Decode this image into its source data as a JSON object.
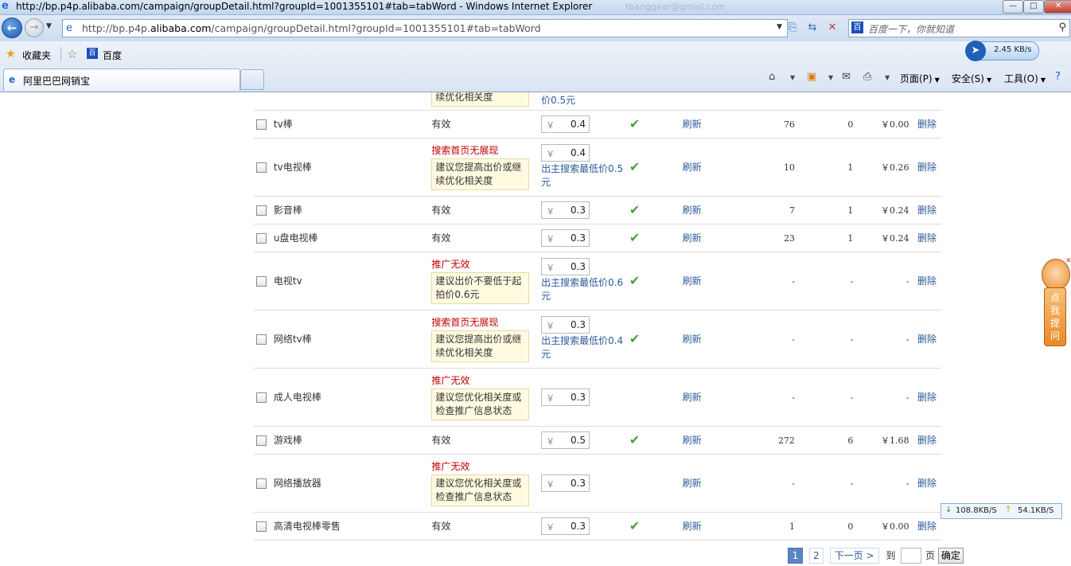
{
  "window": {
    "title": "http://bp.p4p.alibaba.com/campaign/groupDetail.html?groupId=1001355101#tab=tabWord - Windows Internet Explorer",
    "user": "tbanggear@gmail.com",
    "controls": {
      "min": "—",
      "max": "□",
      "close": "✕"
    }
  },
  "address": {
    "url_prefix": "http://bp.p4p.",
    "url_domain": "alibaba.com",
    "url_suffix": "/campaign/groupDetail.html?groupId=1001355101#tab=tabWord"
  },
  "search": {
    "placeholder": "百度一下，你就知道"
  },
  "favorites": {
    "label": "收藏夹",
    "items": [
      "百度"
    ]
  },
  "speed_badge": "2.45 KB/s",
  "tab": {
    "label": "阿里巴巴网销宝"
  },
  "commands": {
    "page": "页面(P)",
    "safety": "安全(S)",
    "tools": "工具(O)"
  },
  "top_partial": {
    "note": "续优化相关度",
    "hint": "价0.5元"
  },
  "rows": [
    {
      "word": "tv棒",
      "status": "有效",
      "bid": "0.4",
      "ok": true,
      "refresh": "刷新",
      "n1": "76",
      "n2": "0",
      "n3": "￥0.00",
      "del": "删除"
    },
    {
      "word": "tv电视棒",
      "status_red": "搜索首页无展现",
      "note": "建议您提高出价或继续优化相关度",
      "bid": "0.4",
      "hint": "出主搜索最低价0.5元",
      "ok": true,
      "refresh": "刷新",
      "n1": "10",
      "n2": "1",
      "n3": "￥0.26",
      "del": "删除"
    },
    {
      "word": "影音棒",
      "status": "有效",
      "bid": "0.3",
      "ok": true,
      "refresh": "刷新",
      "n1": "7",
      "n2": "1",
      "n3": "￥0.24",
      "del": "删除"
    },
    {
      "word": "u盘电视棒",
      "status": "有效",
      "bid": "0.3",
      "ok": true,
      "refresh": "刷新",
      "n1": "23",
      "n2": "1",
      "n3": "￥0.24",
      "del": "删除"
    },
    {
      "word": "电视tv",
      "status_red": "推广无效",
      "note": "建议出价不要低于起拍价0.6元",
      "bid": "0.3",
      "hint": "出主搜索最低价0.6元",
      "ok": true,
      "refresh": "刷新",
      "n1": "-",
      "n2": "-",
      "n3": "-",
      "del": "删除"
    },
    {
      "word": "网络tv棒",
      "status_red": "搜索首页无展现",
      "note": "建议您提高出价或继续优化相关度",
      "bid": "0.3",
      "hint": "出主搜索最低价0.4元",
      "ok": true,
      "refresh": "刷新",
      "n1": "-",
      "n2": "-",
      "n3": "-",
      "del": "删除"
    },
    {
      "word": "成人电视棒",
      "status_red": "推广无效",
      "note": "建议您优化相关度或检查推广信息状态",
      "bid": "0.3",
      "ok": false,
      "refresh": "刷新",
      "n1": "-",
      "n2": "-",
      "n3": "-",
      "del": "删除"
    },
    {
      "word": "游戏棒",
      "status": "有效",
      "bid": "0.5",
      "ok": true,
      "refresh": "刷新",
      "n1": "272",
      "n2": "6",
      "n3": "￥1.68",
      "del": "删除"
    },
    {
      "word": "网络播放器",
      "status_red": "推广无效",
      "note": "建议您优化相关度或检查推广信息状态",
      "bid": "0.3",
      "ok": false,
      "refresh": "刷新",
      "n1": "-",
      "n2": "-",
      "n3": "-",
      "del": "删除"
    },
    {
      "word": "高清电视棒零售",
      "status": "有效",
      "bid": "0.3",
      "ok": true,
      "refresh": "刷新",
      "n1": "1",
      "n2": "0",
      "n3": "￥0.00",
      "del": "删除"
    }
  ],
  "currency_symbol": "￥",
  "pager": {
    "current": "1",
    "page2": "2",
    "next": "下一页 >",
    "to": "到",
    "ye": "页",
    "confirm": "确定"
  },
  "help_widget": {
    "text": "点我提问"
  },
  "net_speed": {
    "down": "108.8KB/S",
    "up": "54.1KB/S"
  }
}
